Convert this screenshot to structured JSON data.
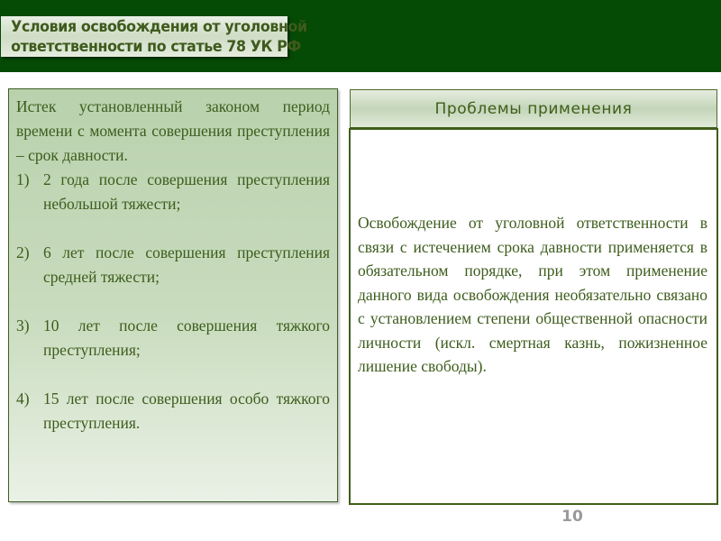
{
  "slide": {
    "title_lines": [
      "Условия освобождения от уголовной",
      "ответственности по статье 78 УК РФ"
    ],
    "left_panel": {
      "intro": "Истек установленный законом период времени с момента совершения преступления – срок давности.",
      "items": [
        {
          "number": "1)",
          "text": "2 года после совершения преступления небольшой тяжести;"
        },
        {
          "number": "2)",
          "text": "6 лет после совершения преступления средней тяжести;"
        },
        {
          "number": "3)",
          "text": "10 лет после совершения тяжкого преступления;"
        },
        {
          "number": "4)",
          "text": "15 лет после совершения особо тяжкого преступления."
        }
      ]
    },
    "right_panel": {
      "header": "Проблемы применения",
      "body": "Освобождение от уголовной ответственности в связи с истечением срока давности применяется в обязательном порядке, при этом применение данного вида освобождения необязательно связано с установлением степени общественной опасности личности (искл. смертная казнь, пожизненное лишение свободы)."
    },
    "page_number": "10",
    "colors": {
      "top_bar": "#054a05",
      "text_green": "#3d5c1c",
      "border_green": "#3f5e1a",
      "page_number": "#999999"
    }
  }
}
